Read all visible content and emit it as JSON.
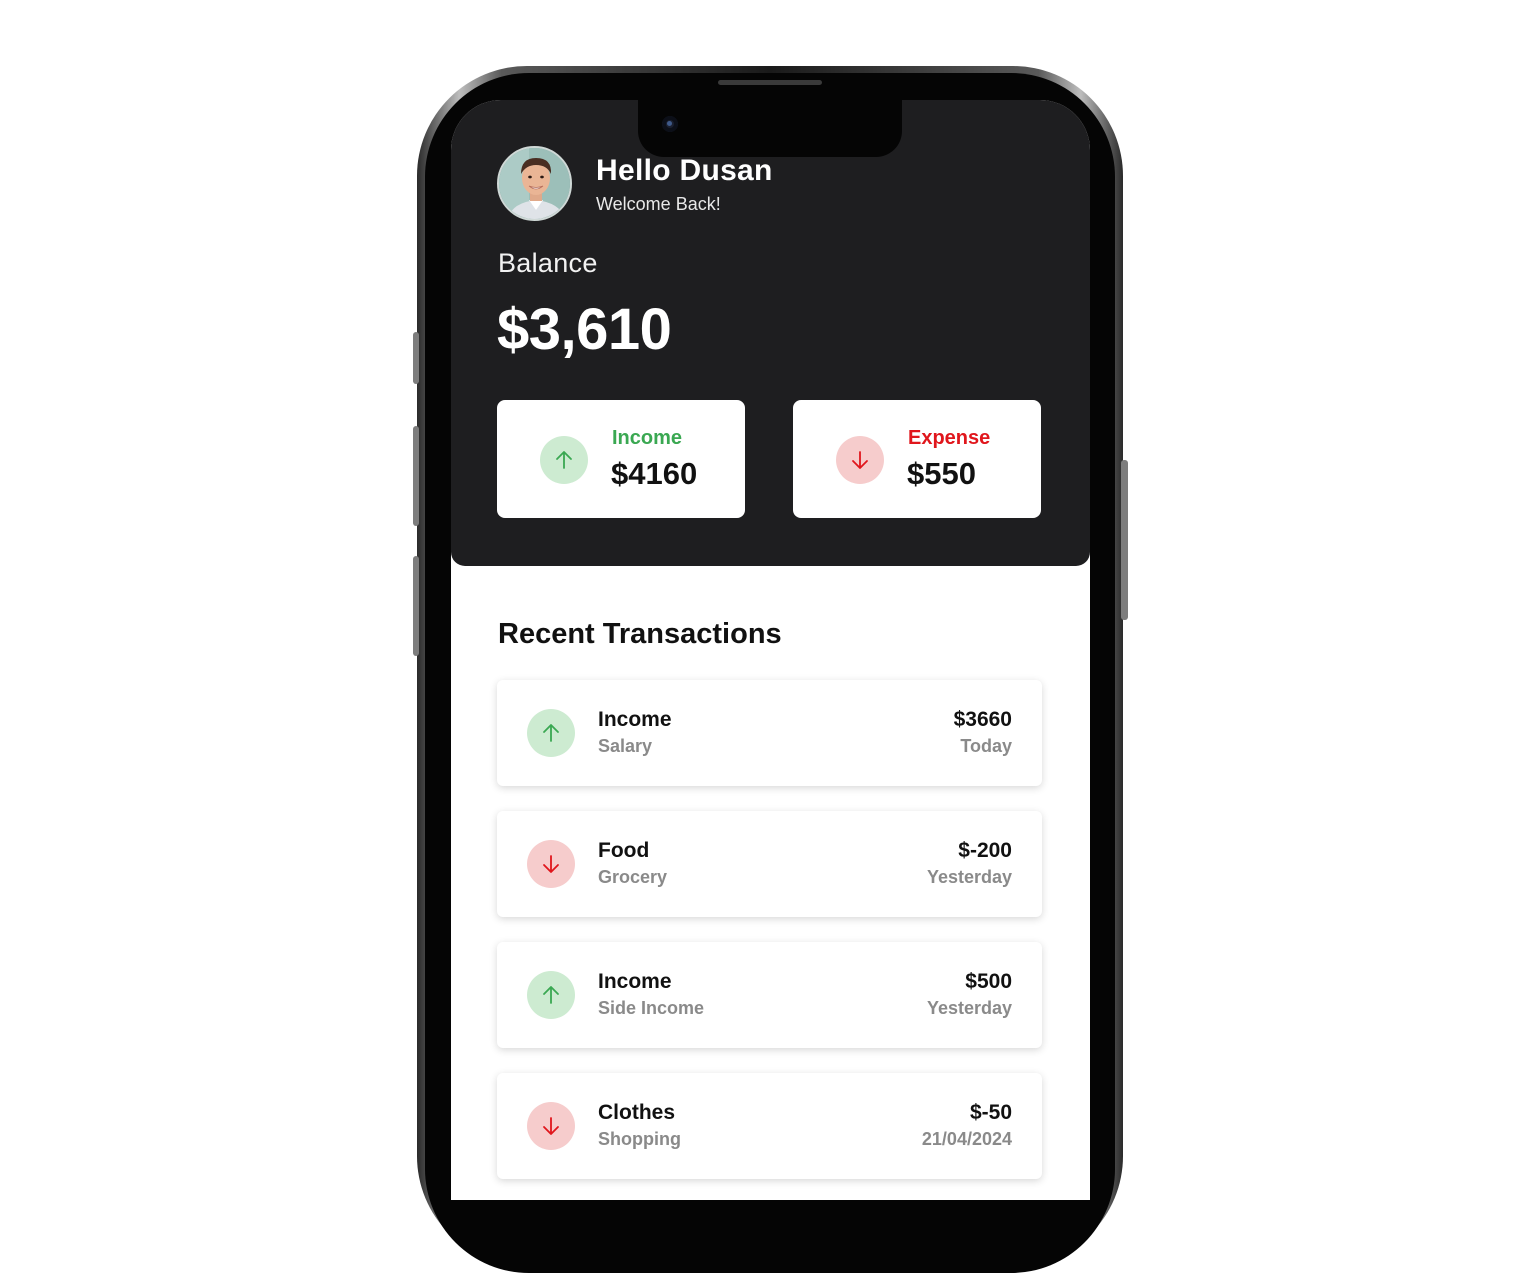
{
  "user": {
    "greeting": "Hello Dusan",
    "subtitle": "Welcome Back!"
  },
  "balance": {
    "label": "Balance",
    "value": "$3,610"
  },
  "summary": {
    "income": {
      "label": "Income",
      "value": "$4160",
      "icon": "arrow-up-icon",
      "color": "#3aa852"
    },
    "expense": {
      "label": "Expense",
      "value": "$550",
      "icon": "arrow-down-icon",
      "color": "#e0161c"
    }
  },
  "transactions_section": {
    "title": "Recent Transactions",
    "items": [
      {
        "type": "income",
        "title": "Income",
        "category": "Salary",
        "amount": "$3660",
        "date": "Today"
      },
      {
        "type": "expense",
        "title": "Food",
        "category": "Grocery",
        "amount": "$-200",
        "date": "Yesterday"
      },
      {
        "type": "income",
        "title": "Income",
        "category": "Side Income",
        "amount": "$500",
        "date": "Yesterday"
      },
      {
        "type": "expense",
        "title": "Clothes",
        "category": "Shopping",
        "amount": "$-50",
        "date": "21/04/2024"
      }
    ]
  },
  "colors": {
    "header_bg": "#1e1e20",
    "income_bg": "#cdebd1",
    "expense_bg": "#f6cccc"
  }
}
